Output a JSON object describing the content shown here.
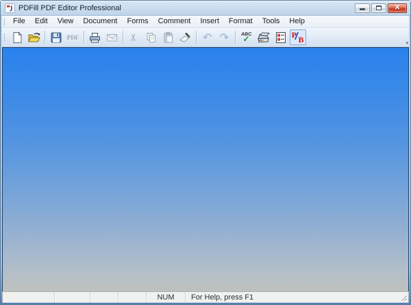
{
  "window": {
    "title": "PDFill PDF Editor Professional",
    "controls": {
      "minimize": "minimize",
      "maximize": "maximize",
      "close": "close",
      "close_glyph": "✕"
    }
  },
  "menu": {
    "items": [
      "File",
      "Edit",
      "View",
      "Document",
      "Forms",
      "Comment",
      "Insert",
      "Format",
      "Tools",
      "Help"
    ]
  },
  "toolbar": {
    "buttons": [
      {
        "name": "new",
        "enabled": true
      },
      {
        "name": "open",
        "enabled": true
      },
      {
        "name": "save",
        "enabled": true
      },
      {
        "name": "save-as-pdf",
        "enabled": false
      },
      {
        "name": "print",
        "enabled": true
      },
      {
        "name": "email",
        "enabled": false
      },
      {
        "name": "cut",
        "enabled": false
      },
      {
        "name": "copy",
        "enabled": false
      },
      {
        "name": "paste",
        "enabled": false
      },
      {
        "name": "whiteout",
        "enabled": true
      },
      {
        "name": "undo",
        "enabled": false
      },
      {
        "name": "redo",
        "enabled": false
      },
      {
        "name": "spellcheck",
        "enabled": true
      },
      {
        "name": "scan",
        "enabled": true
      },
      {
        "name": "form-fields",
        "enabled": true
      },
      {
        "name": "pdf-page-pb",
        "enabled": true
      }
    ],
    "labels": {
      "save_as_pdf": "PDF",
      "spellcheck_abc": "ABC",
      "pb_p": "P",
      "pb_slash": "/",
      "pb_b": "B"
    },
    "glyphs": {
      "cut": "✂",
      "undo": "↶",
      "redo": "↷",
      "spell_check_mark": "✓",
      "overflow": "▾"
    }
  },
  "statusbar": {
    "num_indicator": "NUM",
    "help_text": "For Help, press F1"
  },
  "colors": {
    "workspace_gradient_top": "#2a82ec",
    "workspace_gradient_bottom": "#bfc1bc",
    "frame_blue": "#b2cbe4",
    "close_button_red": "#c2402a",
    "titlebar_text": "#15202e"
  }
}
